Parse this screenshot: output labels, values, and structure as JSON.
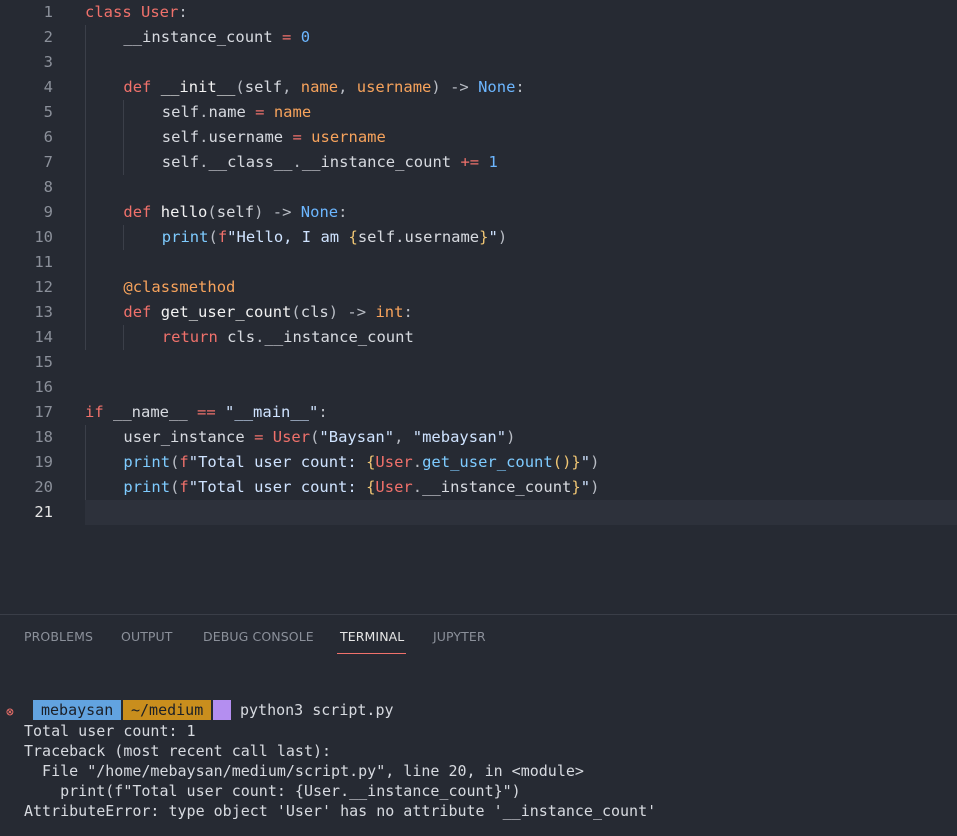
{
  "editor": {
    "active_line": 21,
    "lines": [
      {
        "n": "1"
      },
      {
        "n": "2"
      },
      {
        "n": "3"
      },
      {
        "n": "4"
      },
      {
        "n": "5"
      },
      {
        "n": "6"
      },
      {
        "n": "7"
      },
      {
        "n": "8"
      },
      {
        "n": "9"
      },
      {
        "n": "10"
      },
      {
        "n": "11"
      },
      {
        "n": "12"
      },
      {
        "n": "13"
      },
      {
        "n": "14"
      },
      {
        "n": "15"
      },
      {
        "n": "16"
      },
      {
        "n": "17"
      },
      {
        "n": "18"
      },
      {
        "n": "19"
      },
      {
        "n": "20"
      },
      {
        "n": "21"
      }
    ],
    "code": {
      "l1": [
        [
          "kw",
          "class"
        ],
        [
          "pplain",
          " "
        ],
        [
          "cls",
          "User"
        ],
        [
          "punc",
          ":"
        ]
      ],
      "l2": [
        [
          "var",
          "__instance_count"
        ],
        [
          "pplain",
          " "
        ],
        [
          "op",
          "="
        ],
        [
          "pplain",
          " "
        ],
        [
          "num",
          "0"
        ]
      ],
      "l3": [],
      "l4": [
        [
          "kw",
          "def"
        ],
        [
          "pplain",
          " "
        ],
        [
          "fn",
          "__init__"
        ],
        [
          "punc",
          "("
        ],
        [
          "self",
          "self"
        ],
        [
          "punc",
          ", "
        ],
        [
          "param",
          "name"
        ],
        [
          "punc",
          ", "
        ],
        [
          "param",
          "username"
        ],
        [
          "punc",
          ")"
        ],
        [
          "pplain",
          " "
        ],
        [
          "punc",
          "->"
        ],
        [
          "pplain",
          " "
        ],
        [
          "type",
          "None"
        ],
        [
          "punc",
          ":"
        ]
      ],
      "l5": [
        [
          "self",
          "self"
        ],
        [
          "punc",
          "."
        ],
        [
          "var",
          "name"
        ],
        [
          "pplain",
          " "
        ],
        [
          "op",
          "="
        ],
        [
          "pplain",
          " "
        ],
        [
          "param",
          "name"
        ]
      ],
      "l6": [
        [
          "self",
          "self"
        ],
        [
          "punc",
          "."
        ],
        [
          "var",
          "username"
        ],
        [
          "pplain",
          " "
        ],
        [
          "op",
          "="
        ],
        [
          "pplain",
          " "
        ],
        [
          "param",
          "username"
        ]
      ],
      "l7": [
        [
          "self",
          "self"
        ],
        [
          "punc",
          "."
        ],
        [
          "var",
          "__class__"
        ],
        [
          "punc",
          "."
        ],
        [
          "var",
          "__instance_count"
        ],
        [
          "pplain",
          " "
        ],
        [
          "op",
          "+="
        ],
        [
          "pplain",
          " "
        ],
        [
          "num",
          "1"
        ]
      ],
      "l8": [],
      "l9": [
        [
          "kw",
          "def"
        ],
        [
          "pplain",
          " "
        ],
        [
          "fn",
          "hello"
        ],
        [
          "punc",
          "("
        ],
        [
          "self",
          "self"
        ],
        [
          "punc",
          ")"
        ],
        [
          "pplain",
          " "
        ],
        [
          "punc",
          "->"
        ],
        [
          "pplain",
          " "
        ],
        [
          "type",
          "None"
        ],
        [
          "punc",
          ":"
        ]
      ],
      "l10": [
        [
          "builtin",
          "print"
        ],
        [
          "punc",
          "("
        ],
        [
          "kw",
          "f"
        ],
        [
          "str",
          "\"Hello, I am "
        ],
        [
          "brace",
          "{"
        ],
        [
          "self",
          "self.username"
        ],
        [
          "brace",
          "}"
        ],
        [
          "str",
          "\""
        ],
        [
          "punc",
          ")"
        ]
      ],
      "l11": [],
      "l12": [
        [
          "deco",
          "@classmethod"
        ]
      ],
      "l13": [
        [
          "kw",
          "def"
        ],
        [
          "pplain",
          " "
        ],
        [
          "fn",
          "get_user_count"
        ],
        [
          "punc",
          "("
        ],
        [
          "self",
          "cls"
        ],
        [
          "punc",
          ")"
        ],
        [
          "pplain",
          " "
        ],
        [
          "punc",
          "->"
        ],
        [
          "pplain",
          " "
        ],
        [
          "param",
          "int"
        ],
        [
          "punc",
          ":"
        ]
      ],
      "l14": [
        [
          "kw",
          "return"
        ],
        [
          "pplain",
          " "
        ],
        [
          "self",
          "cls"
        ],
        [
          "punc",
          "."
        ],
        [
          "var",
          "__instance_count"
        ]
      ],
      "l15": [],
      "l16": [],
      "l17": [
        [
          "kw",
          "if"
        ],
        [
          "pplain",
          " "
        ],
        [
          "var",
          "__name__"
        ],
        [
          "pplain",
          " "
        ],
        [
          "op",
          "=="
        ],
        [
          "pplain",
          " "
        ],
        [
          "str",
          "\"__main__\""
        ],
        [
          "punc",
          ":"
        ]
      ],
      "l18": [
        [
          "var",
          "user_instance"
        ],
        [
          "pplain",
          " "
        ],
        [
          "op",
          "="
        ],
        [
          "pplain",
          " "
        ],
        [
          "cls",
          "User"
        ],
        [
          "punc",
          "("
        ],
        [
          "str",
          "\"Baysan\""
        ],
        [
          "punc",
          ", "
        ],
        [
          "str",
          "\"mebaysan\""
        ],
        [
          "punc",
          ")"
        ]
      ],
      "l19": [
        [
          "builtin",
          "print"
        ],
        [
          "punc",
          "("
        ],
        [
          "kw",
          "f"
        ],
        [
          "str",
          "\"Total user count: "
        ],
        [
          "brace",
          "{"
        ],
        [
          "cls",
          "User"
        ],
        [
          "punc",
          "."
        ],
        [
          "builtin",
          "get_user_count"
        ],
        [
          "brace",
          "()"
        ],
        [
          "brace",
          "}"
        ],
        [
          "str",
          "\""
        ],
        [
          "punc",
          ")"
        ]
      ],
      "l20": [
        [
          "builtin",
          "print"
        ],
        [
          "punc",
          "("
        ],
        [
          "kw",
          "f"
        ],
        [
          "str",
          "\"Total user count: "
        ],
        [
          "brace",
          "{"
        ],
        [
          "cls",
          "User"
        ],
        [
          "punc",
          "."
        ],
        [
          "var",
          "__instance_count"
        ],
        [
          "brace",
          "}"
        ],
        [
          "str",
          "\""
        ],
        [
          "punc",
          ")"
        ]
      ],
      "l21": []
    }
  },
  "panel": {
    "tabs": [
      {
        "label": "PROBLEMS"
      },
      {
        "label": "OUTPUT"
      },
      {
        "label": "DEBUG CONSOLE"
      },
      {
        "label": "TERMINAL",
        "active": true
      },
      {
        "label": "JUPYTER"
      }
    ],
    "terminal": {
      "error_icon": "⊗",
      "prompt_user": "mebaysan",
      "prompt_path": "~/medium",
      "command": "python3 script.py",
      "output": [
        "Total user count: 1",
        "Traceback (most recent call last):",
        "  File \"/home/mebaysan/medium/script.py\", line 20, in <module>",
        "    print(f\"Total user count: {User.__instance_count}\")",
        "AttributeError: type object 'User' has no attribute '__instance_count'"
      ]
    }
  },
  "colors": {
    "background": "#262a33",
    "keyword": "#f0716b",
    "number": "#6cb6ff",
    "param": "#f7a35c",
    "prompt_user_bg": "#62a3e0",
    "prompt_path_bg": "#c98e1d",
    "prompt_end_bg": "#b48ef0"
  }
}
